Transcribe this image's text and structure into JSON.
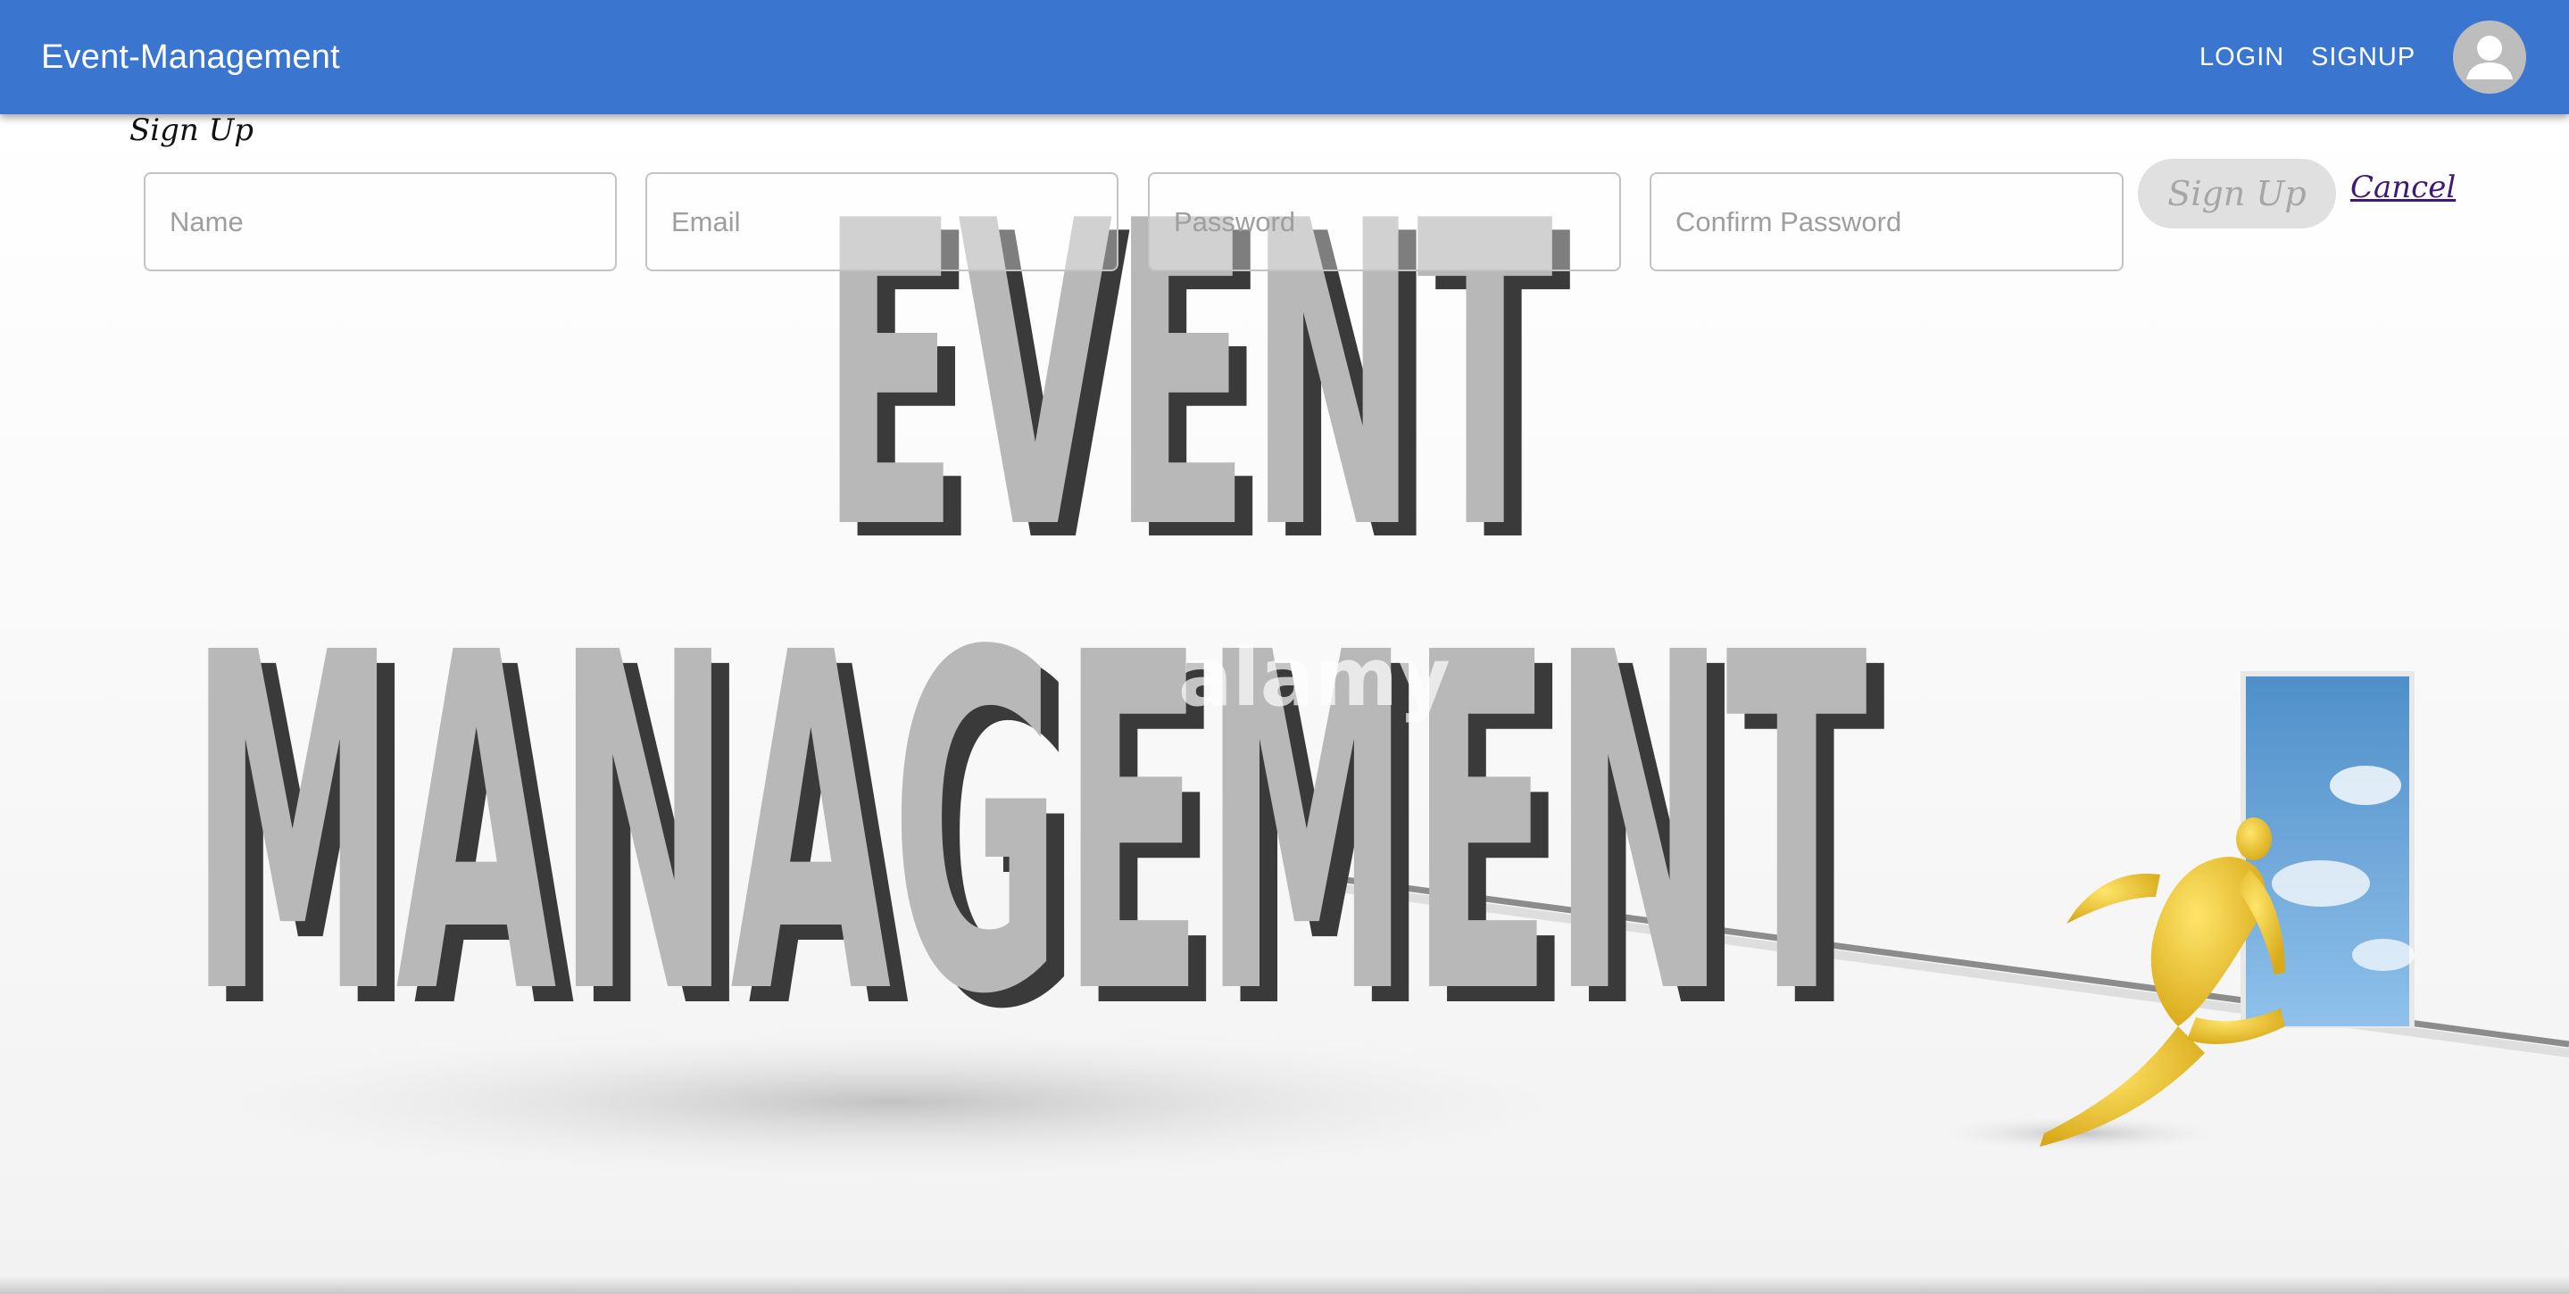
{
  "appbar": {
    "title": "Event-Management",
    "login_label": "LOGIN",
    "signup_label": "SIGNUP",
    "avatar_icon": "account-circle-icon",
    "color": "#3a76d0"
  },
  "form": {
    "title": "Sign Up",
    "name_placeholder": "Name",
    "email_placeholder": "Email",
    "password_placeholder": "Password",
    "confirm_password_placeholder": "Confirm Password",
    "submit_label": "Sign Up",
    "cancel_label": "Cancel"
  },
  "background": {
    "headline_line1": "EVENT",
    "headline_line2": "MANAGEMENT",
    "watermark": "alamy"
  }
}
